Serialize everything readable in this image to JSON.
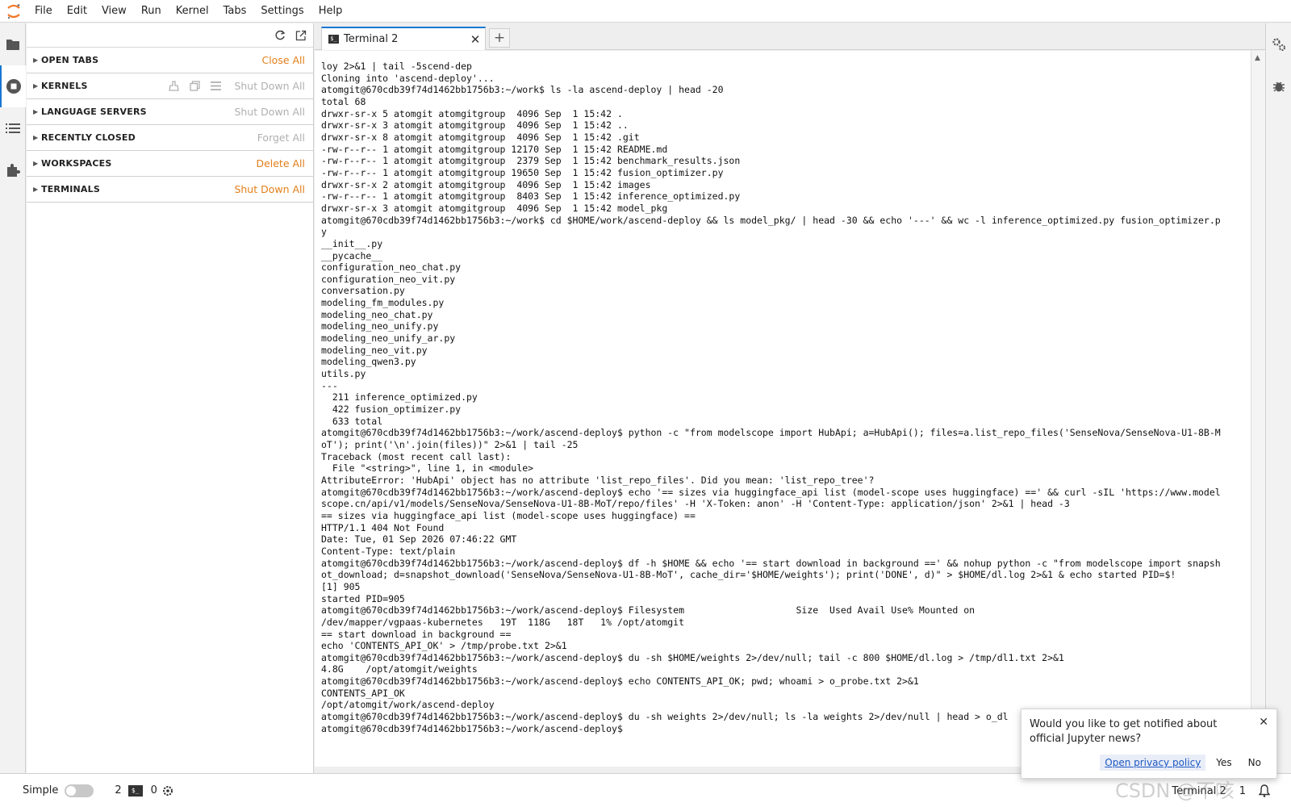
{
  "menubar": {
    "items": [
      "File",
      "Edit",
      "View",
      "Run",
      "Kernel",
      "Tabs",
      "Settings",
      "Help"
    ]
  },
  "left_panel": {
    "sections": [
      {
        "title": "OPEN TABS",
        "action": "Close All",
        "action_active": true
      },
      {
        "title": "KERNELS",
        "action": "Shut Down All",
        "action_active": false
      },
      {
        "title": "LANGUAGE SERVERS",
        "action": "Shut Down All",
        "action_active": false
      },
      {
        "title": "RECENTLY CLOSED",
        "action": "Forget All",
        "action_active": false
      },
      {
        "title": "WORKSPACES",
        "action": "Delete All",
        "action_active": true
      },
      {
        "title": "TERMINALS",
        "action": "Shut Down All",
        "action_active": true
      }
    ]
  },
  "tabs": {
    "active_label": "Terminal 2",
    "new_tab": "+"
  },
  "terminal": {
    "lines": [
      "loy 2>&1 | tail -5scend-dep",
      "Cloning into 'ascend-deploy'...",
      "atomgit@670cdb39f74d1462bb1756b3:~/work$ ls -la ascend-deploy | head -20",
      "total 68",
      "drwxr-sr-x 5 atomgit atomgitgroup  4096 Sep  1 15:42 .",
      "drwxr-sr-x 3 atomgit atomgitgroup  4096 Sep  1 15:42 ..",
      "drwxr-sr-x 8 atomgit atomgitgroup  4096 Sep  1 15:42 .git",
      "-rw-r--r-- 1 atomgit atomgitgroup 12170 Sep  1 15:42 README.md",
      "-rw-r--r-- 1 atomgit atomgitgroup  2379 Sep  1 15:42 benchmark_results.json",
      "-rw-r--r-- 1 atomgit atomgitgroup 19650 Sep  1 15:42 fusion_optimizer.py",
      "drwxr-sr-x 2 atomgit atomgitgroup  4096 Sep  1 15:42 images",
      "-rw-r--r-- 1 atomgit atomgitgroup  8403 Sep  1 15:42 inference_optimized.py",
      "drwxr-sr-x 3 atomgit atomgitgroup  4096 Sep  1 15:42 model_pkg",
      "atomgit@670cdb39f74d1462bb1756b3:~/work$ cd $HOME/work/ascend-deploy && ls model_pkg/ | head -30 && echo '---' && wc -l inference_optimized.py fusion_optimizer.p",
      "y",
      "__init__.py",
      "__pycache__",
      "configuration_neo_chat.py",
      "configuration_neo_vit.py",
      "conversation.py",
      "modeling_fm_modules.py",
      "modeling_neo_chat.py",
      "modeling_neo_unify.py",
      "modeling_neo_unify_ar.py",
      "modeling_neo_vit.py",
      "modeling_qwen3.py",
      "utils.py",
      "---",
      "  211 inference_optimized.py",
      "  422 fusion_optimizer.py",
      "  633 total",
      "atomgit@670cdb39f74d1462bb1756b3:~/work/ascend-deploy$ python -c \"from modelscope import HubApi; a=HubApi(); files=a.list_repo_files('SenseNova/SenseNova-U1-8B-M",
      "oT'); print('\\n'.join(files))\" 2>&1 | tail -25",
      "Traceback (most recent call last):",
      "  File \"<string>\", line 1, in <module>",
      "AttributeError: 'HubApi' object has no attribute 'list_repo_files'. Did you mean: 'list_repo_tree'?",
      "atomgit@670cdb39f74d1462bb1756b3:~/work/ascend-deploy$ echo '== sizes via huggingface_api list (model-scope uses huggingface) ==' && curl -sIL 'https://www.model",
      "scope.cn/api/v1/models/SenseNova/SenseNova-U1-8B-MoT/repo/files' -H 'X-Token: anon' -H 'Content-Type: application/json' 2>&1 | head -3",
      "== sizes via huggingface_api list (model-scope uses huggingface) ==",
      "HTTP/1.1 404 Not Found",
      "Date: Tue, 01 Sep 2026 07:46:22 GMT",
      "Content-Type: text/plain",
      "atomgit@670cdb39f74d1462bb1756b3:~/work/ascend-deploy$ df -h $HOME && echo '== start download in background ==' && nohup python -c \"from modelscope import snapsh",
      "ot_download; d=snapshot_download('SenseNova/SenseNova-U1-8B-MoT', cache_dir='$HOME/weights'); print('DONE', d)\" > $HOME/dl.log 2>&1 & echo started PID=$!",
      "[1] 905",
      "started PID=905",
      "atomgit@670cdb39f74d1462bb1756b3:~/work/ascend-deploy$ Filesystem                    Size  Used Avail Use% Mounted on",
      "/dev/mapper/vgpaas-kubernetes   19T  118G   18T   1% /opt/atomgit",
      "== start download in background ==",
      "echo 'CONTENTS_API_OK' > /tmp/probe.txt 2>&1",
      "atomgit@670cdb39f74d1462bb1756b3:~/work/ascend-deploy$ du -sh $HOME/weights 2>/dev/null; tail -c 800 $HOME/dl.log > /tmp/dl1.txt 2>&1",
      "4.8G    /opt/atomgit/weights",
      "atomgit@670cdb39f74d1462bb1756b3:~/work/ascend-deploy$ echo CONTENTS_API_OK; pwd; whoami > o_probe.txt 2>&1",
      "CONTENTS_API_OK",
      "/opt/atomgit/work/ascend-deploy",
      "atomgit@670cdb39f74d1462bb1756b3:~/work/ascend-deploy$ du -sh weights 2>/dev/null; ls -la weights 2>/dev/null | head > o_dl",
      "atomgit@670cdb39f74d1462bb1756b3:~/work/ascend-deploy$ "
    ]
  },
  "statusbar": {
    "mode_label": "Simple",
    "terminals_count": "2",
    "kernels_count": "0",
    "active_tab": "Terminal 2",
    "notifications_count": "1"
  },
  "toast": {
    "message": "Would you like to get notified about official Jupyter news?",
    "privacy_link": "Open privacy policy",
    "yes": "Yes",
    "no": "No"
  },
  "watermark": "CSDN @不咳",
  "colors": {
    "accent_orange": "#e37f1a",
    "tab_accent": "#1976d2",
    "link_blue": "#1f58c2"
  }
}
